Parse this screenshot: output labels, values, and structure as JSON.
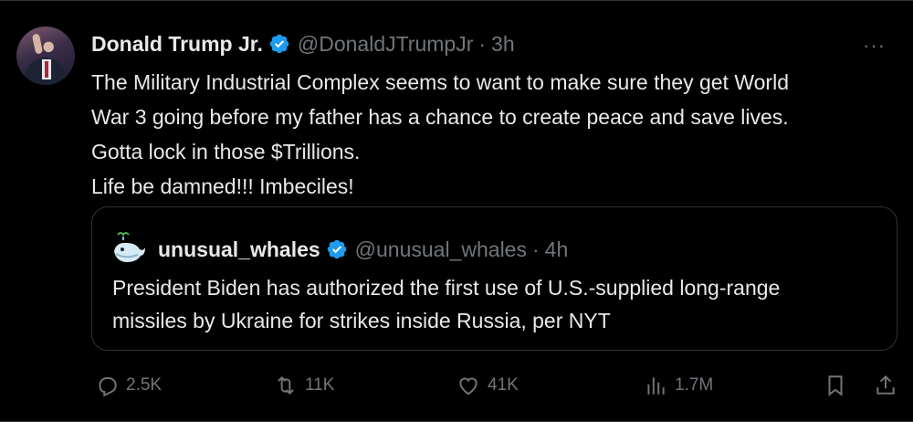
{
  "author": {
    "name": "Donald Trump Jr.",
    "handle": "@DonaldJTrumpJr",
    "separator": "·",
    "time": "3h",
    "more": "···"
  },
  "tweet": {
    "lines": [
      "The Military Industrial Complex seems to want to make sure they get World",
      "War 3 going before my father has a chance to create peace and save lives.",
      "Gotta lock in those $Trillions.",
      "Life be damned!!! Imbeciles!"
    ]
  },
  "quote": {
    "name": "unusual_whales",
    "handle": "@unusual_whales",
    "separator": "·",
    "time": "4h",
    "lines": [
      "President Biden has authorized the first use of U.S.-supplied long-range",
      "missiles by Ukraine for strikes inside Russia, per NYT"
    ]
  },
  "stats": {
    "replies": "2.5K",
    "reposts": "11K",
    "likes": "41K",
    "views": "1.7M"
  },
  "colors": {
    "background": "#000000",
    "text": "#e7e9ea",
    "muted": "#71767b",
    "verified": "#1d9bf0",
    "border": "#2f3336"
  }
}
